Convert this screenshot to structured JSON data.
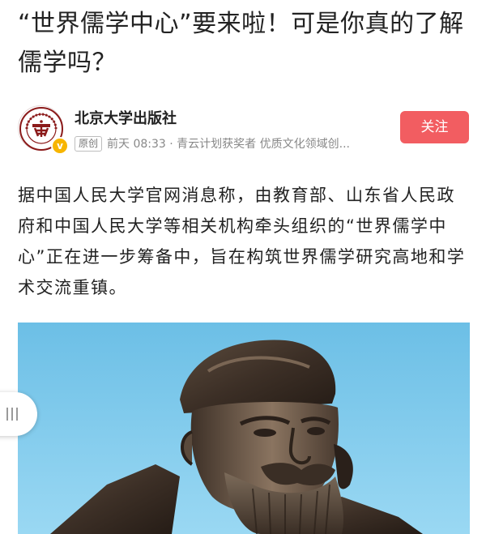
{
  "article": {
    "title": "“世界儒学中心”要来啦！可是你真的了解儒学吗？",
    "paragraph": "据中国人民大学官网消息称，由教育部、山东省人民政府和中国人民大学等相关机构牵头组织的“世界儒学中心”正在进一步筹备中，旨在构筑世界儒学研究高地和学术交流重镇。"
  },
  "author": {
    "name": "北京大学出版社",
    "badge": "原创",
    "time": "前天 08:33",
    "separator": " · ",
    "tagline": "青云计划获奖者 优质文化领域创...",
    "verified_icon": "v-badge-icon",
    "logo_icon": "peking-university-seal-icon",
    "logo_ring_text": "PEKING UNIVERSITY 1898"
  },
  "actions": {
    "follow_label": "关注",
    "follow_color": "#f25d61"
  },
  "side_handle": {
    "icon": "three-bars-icon"
  },
  "image": {
    "subject": "confucius-statue"
  }
}
